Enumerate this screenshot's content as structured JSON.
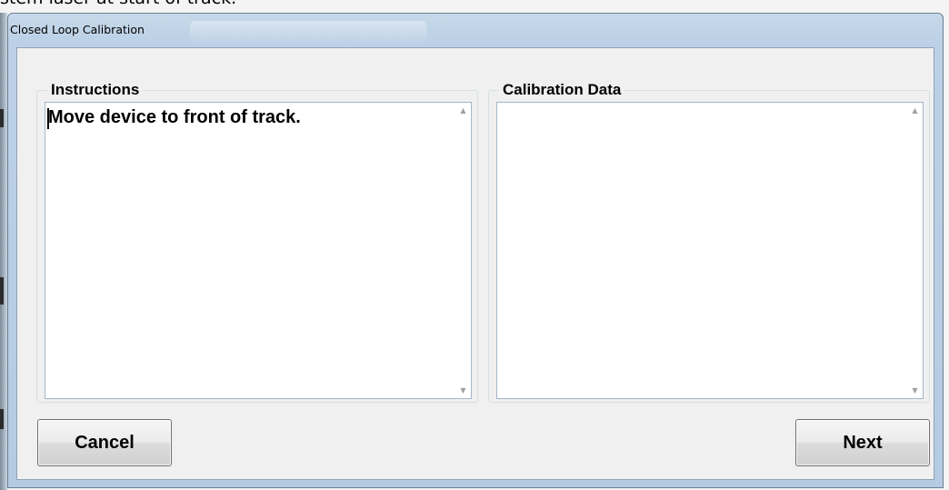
{
  "background": {
    "partial_text": "stem laser at start of track."
  },
  "window": {
    "title": "Closed Loop Calibration"
  },
  "instructions": {
    "label": "Instructions",
    "text": "Move device to front of track."
  },
  "calibration_data": {
    "label": "Calibration Data",
    "text": ""
  },
  "buttons": {
    "cancel": "Cancel",
    "next": "Next"
  },
  "icons": {
    "scroll_up": "scroll-up-arrow-icon",
    "scroll_down": "scroll-down-arrow-icon"
  },
  "colors": {
    "title_bar": "#bcd1e6",
    "client_area": "#f0f0f0",
    "textbox_border": "#a4b7c9"
  }
}
